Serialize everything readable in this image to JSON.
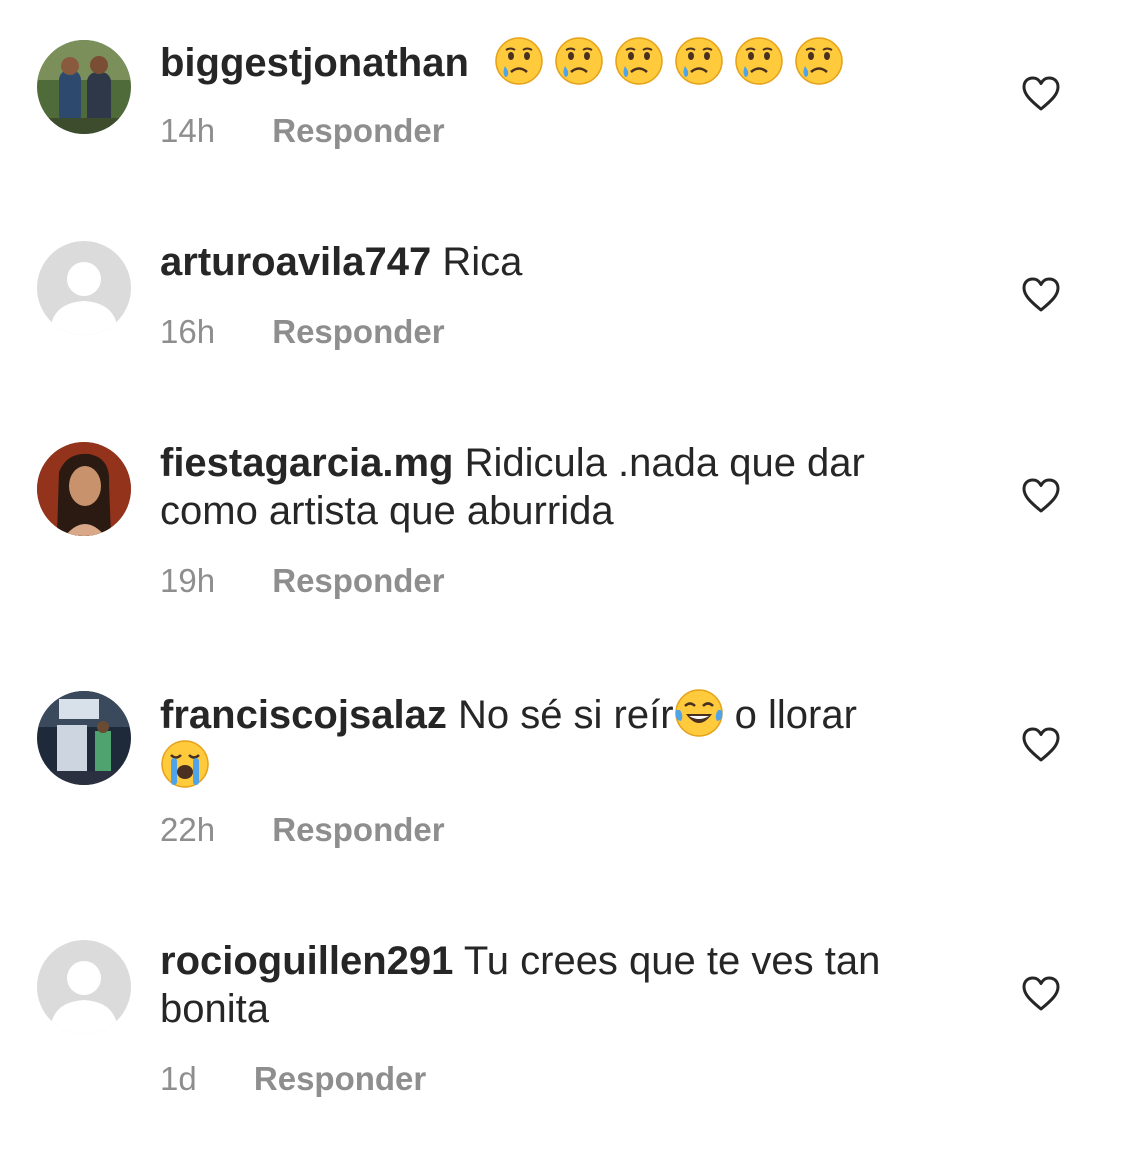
{
  "comments": [
    {
      "username": "biggestjonathan",
      "text": "",
      "emojis": [
        "crying-face",
        "crying-face",
        "crying-face",
        "crying-face",
        "crying-face",
        "crying-face"
      ],
      "time": "14h",
      "reply": "Responder",
      "avatar": "photo"
    },
    {
      "username": "arturoavila747",
      "text": "Rica",
      "time": "16h",
      "reply": "Responder",
      "avatar": "default"
    },
    {
      "username": "fiestagarcia.mg",
      "text": "Ridicula .nada que dar como artista que aburrida",
      "time": "19h",
      "reply": "Responder",
      "avatar": "photo"
    },
    {
      "username": "franciscojsalaz",
      "text_before": "No sé si reír",
      "text_middle": " o llorar",
      "emojis": [
        "tears-of-joy",
        "loudly-crying-face"
      ],
      "time": "22h",
      "reply": "Responder",
      "avatar": "photo"
    },
    {
      "username": "rocioguillen291",
      "text": "Tu crees que te ves tan bonita",
      "time": "1d",
      "reply": "Responder",
      "avatar": "default"
    }
  ],
  "colors": {
    "text": "#262626",
    "secondary": "#8e8e8e",
    "default_avatar_bg": "#dbdbdb"
  }
}
